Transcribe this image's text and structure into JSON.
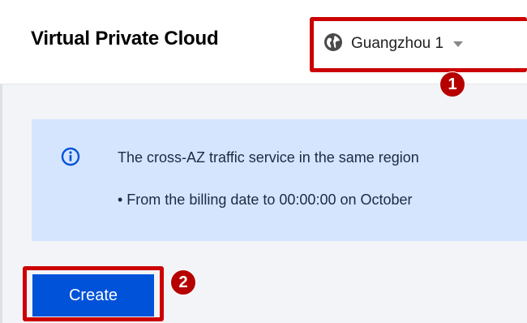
{
  "header": {
    "title": "Virtual Private Cloud",
    "region": {
      "label": "Guangzhou 1",
      "icon": "globe-icon"
    }
  },
  "notice": {
    "icon": "info-icon",
    "line1": "The cross-AZ traffic service in the same region",
    "line2": "• From the billing date to 00:00:00 on October"
  },
  "actions": {
    "create_label": "Create"
  },
  "annotations": {
    "step1": "1",
    "step2": "2"
  },
  "colors": {
    "primary": "#0052d9",
    "highlight": "#cc0000",
    "badge": "#b60000",
    "notice_bg": "#d5e5fe"
  }
}
